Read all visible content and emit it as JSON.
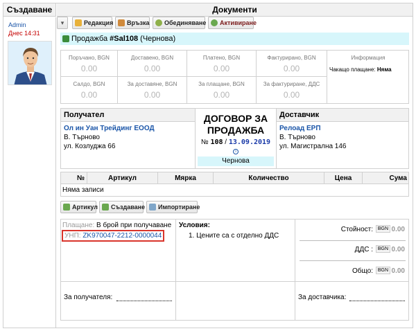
{
  "header": {
    "left_title": "Създаване",
    "right_title": "Документи"
  },
  "sidebar": {
    "user": "Admin",
    "time": "Днес 14:31"
  },
  "toolbar": {
    "edit": "Редакция",
    "link": "Връзка",
    "merge": "Обединяване",
    "activate": "Активиране"
  },
  "doc_title": {
    "prefix": "Продажба ",
    "code": "#Sal108",
    "state": " (Чернова)"
  },
  "totals": {
    "ordered_label": "Поръчано, BGN",
    "ordered": "0.00",
    "delivered_label": "Доставено, BGN",
    "delivered": "0.00",
    "paid_label": "Платено, BGN",
    "paid": "0.00",
    "invoiced_label": "Фактурирано, BGN",
    "invoiced": "0.00",
    "balance_label": "Салдо, BGN",
    "balance": "0.00",
    "to_deliver_label": "За доставяне, BGN",
    "to_deliver": "0.00",
    "to_pay_label": "За плащане, BGN",
    "to_pay": "0.00",
    "to_invoice_label": "За фактуриране, ДДС",
    "to_invoice": "0.00",
    "info_label": "Информация",
    "payment_wait_label": "Чакащо плащане",
    "payment_wait_value": "Няма"
  },
  "recipient": {
    "heading": "Получател",
    "name": "Ол ин Уан Трейдинг ЕООД",
    "city": "В. Търново",
    "street": "ул. Козлуджа 66"
  },
  "contract": {
    "title_line1": "ДОГОВОР ЗА",
    "title_line2": "ПРОДАЖБА",
    "number_prefix": "№",
    "number": "108",
    "separator": " / ",
    "date": "13.09.2019",
    "status": "Чернова"
  },
  "supplier": {
    "heading": "Доставчик",
    "name": "Релоад ЕРП",
    "city": "В. Търново",
    "street": "ул. Магистрална 146"
  },
  "items_table": {
    "columns": [
      "№",
      "Артикул",
      "Мярка",
      "Количество",
      "Цена",
      "Сума"
    ],
    "empty": "Няма записи"
  },
  "toolbar2": {
    "article": "Артикул",
    "create": "Създаване",
    "import": "Импортиране"
  },
  "payment": {
    "label": "Плащане:",
    "value": " В брой при получаване",
    "unp_label": "УНП:",
    "unp_value": " ZK970047-2212-0000044"
  },
  "conditions": {
    "heading": "Условия:",
    "item": "1. Цените са с отделно ДДС"
  },
  "summary": {
    "cost_label": "Стойност:",
    "cost_currency": "BGN",
    "cost": "0.00",
    "vat_label": "ДДС :",
    "vat_currency": "BGN",
    "vat": "0.00",
    "total_label": "Общо:",
    "total_currency": "BGN",
    "total": "0.00"
  },
  "signatures": {
    "recipient": "За получателя:",
    "supplier": "За доставчика:"
  },
  "colors": {
    "accent_blue": "#1a55a8",
    "highlight": "#d7f6fb",
    "alert_red": "#d9342b"
  }
}
